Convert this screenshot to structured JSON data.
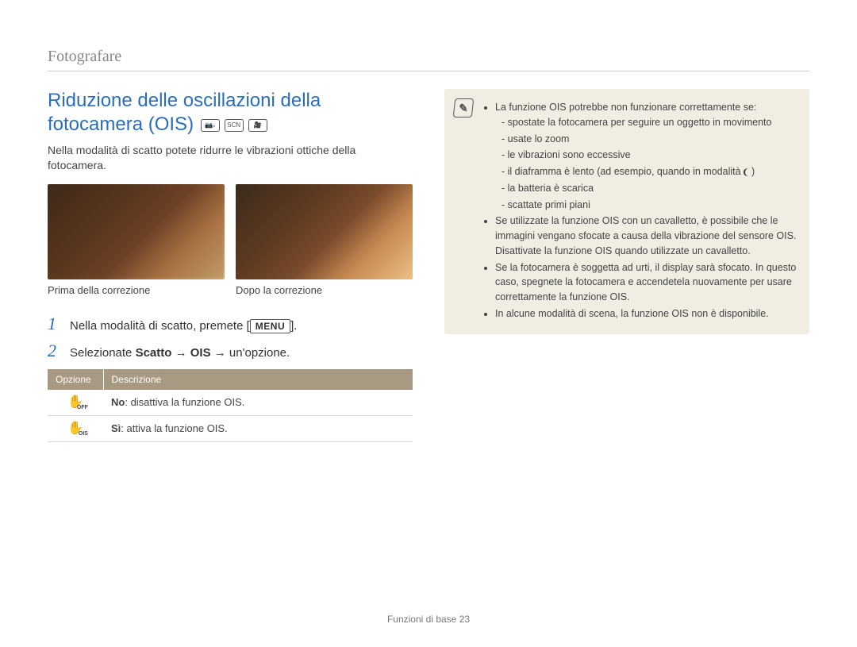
{
  "section_label": "Fotografare",
  "title": "Riduzione delle oscillazioni della fotocamera (OIS)",
  "mode_icons": [
    "camera-p-icon",
    "scene-icon",
    "video-icon"
  ],
  "intro": "Nella modalità di scatto potete ridurre le vibrazioni ottiche della fotocamera.",
  "photos": {
    "before_caption": "Prima della correzione",
    "after_caption": "Dopo la correzione"
  },
  "steps": {
    "s1_prefix": "Nella modalità di scatto, premete [",
    "s1_btn": "MENU",
    "s1_suffix": "].",
    "s2_prefix": "Selezionate ",
    "s2_bold1": "Scatto",
    "s2_arrow1": " → ",
    "s2_bold2": "OIS",
    "s2_arrow2": " → un'opzione."
  },
  "table": {
    "header_option": "Opzione",
    "header_desc": "Descrizione",
    "rows": [
      {
        "icon_sub": "OFF",
        "bold": "No",
        "text": ": disattiva la funzione OIS."
      },
      {
        "icon_sub": "OIS",
        "bold": "Sì",
        "text": ": attiva la funzione OIS."
      }
    ]
  },
  "note": {
    "b1": "La funzione OIS potrebbe non funzionare correttamente se:",
    "b1_subs": [
      "spostate la fotocamera per seguire un oggetto in movimento",
      "usate lo zoom",
      "le vibrazioni sono eccessive",
      "il diaframma è lento (ad esempio, quando in modalità ",
      ")",
      "la batteria è scarica",
      "scattate primi piani"
    ],
    "b2": "Se utilizzate la funzione OIS con un cavalletto, è possibile che le immagini vengano sfocate a causa della vibrazione del sensore OIS. Disattivate la funzione OIS quando utilizzate un cavalletto.",
    "b3": "Se la fotocamera è soggetta ad urti, il display sarà sfocato. In questo caso, spegnete la fotocamera e accendetela nuovamente per usare correttamente la funzione OIS.",
    "b4": "In alcune modalità di scena, la funzione OIS non è disponibile."
  },
  "footer_label": "Funzioni di base",
  "footer_page": "23"
}
